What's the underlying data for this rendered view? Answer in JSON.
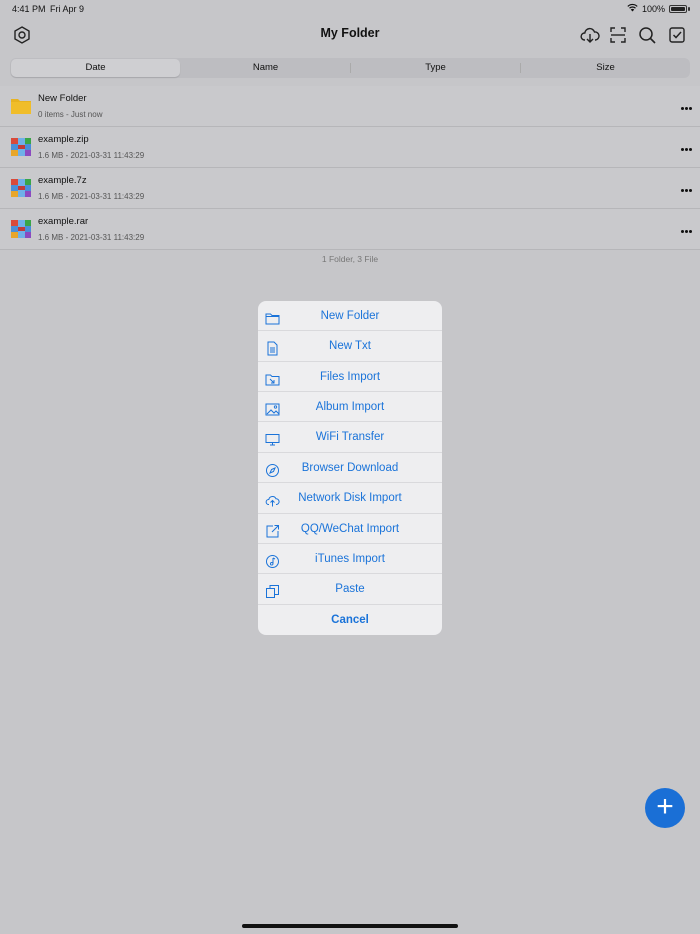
{
  "status": {
    "time": "4:41 PM",
    "date": "Fri Apr 9",
    "battery": "100%"
  },
  "navbar": {
    "title": "My Folder",
    "left_icon": "settings-icon",
    "right_icons": [
      "cloud-download-icon",
      "scan-icon",
      "search-icon",
      "select-checkbox-icon"
    ]
  },
  "sort_tabs": [
    "Date",
    "Name",
    "Type",
    "Size"
  ],
  "selected_tab": "Date",
  "files": [
    {
      "name": "New Folder",
      "meta": "0 items - Just now",
      "icon": "folder-icon"
    },
    {
      "name": "example.zip",
      "meta": "1.6 MB - 2021-03-31 11:43:29",
      "icon": "archive-icon"
    },
    {
      "name": "example.7z",
      "meta": "1.6 MB - 2021-03-31 11:43:29",
      "icon": "archive-icon"
    },
    {
      "name": "example.rar",
      "meta": "1.6 MB - 2021-03-31 11:43:29",
      "icon": "archive-icon"
    }
  ],
  "summary": "1 Folder,  3 File",
  "menu": [
    {
      "label": "New Folder",
      "icon": "folder-outline-icon"
    },
    {
      "label": "New Txt",
      "icon": "document-icon"
    },
    {
      "label": "Files Import",
      "icon": "folder-import-icon"
    },
    {
      "label": "Album Import",
      "icon": "photo-icon"
    },
    {
      "label": "WiFi Transfer",
      "icon": "monitor-icon"
    },
    {
      "label": "Browser Download",
      "icon": "compass-icon"
    },
    {
      "label": "Network Disk Import",
      "icon": "cloud-upload-icon"
    },
    {
      "label": "QQ/WeChat Import",
      "icon": "share-external-icon"
    },
    {
      "label": "iTunes Import",
      "icon": "music-note-icon"
    },
    {
      "label": "Paste",
      "icon": "copy-icon"
    }
  ],
  "cancel_label": "Cancel",
  "fab_label": "+",
  "colors": {
    "accent": "#1a73d9",
    "fab": "#1a6fd6",
    "folder": "#e8b320"
  }
}
